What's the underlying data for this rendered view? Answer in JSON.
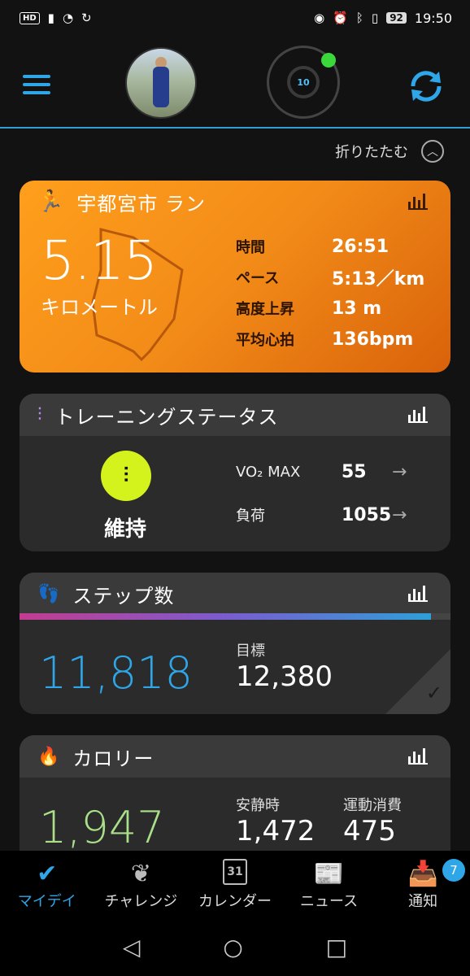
{
  "status_bar": {
    "left_badge": "HD",
    "battery": "92",
    "time": "19:50"
  },
  "header": {
    "watch_face_text": "10"
  },
  "collapse_label": "折りたたむ",
  "activity": {
    "title": "宇都宮市 ラン",
    "distance": "5.15",
    "distance_unit": "キロメートル",
    "stats": [
      {
        "label": "時間",
        "value": "26:51"
      },
      {
        "label": "ペース",
        "value": "5:13／km"
      },
      {
        "label": "高度上昇",
        "value": "13 m"
      },
      {
        "label": "平均心拍",
        "value": "136bpm"
      }
    ]
  },
  "training": {
    "title": "トレーニングステータス",
    "status": "維持",
    "vo2_label": "VO₂ MAX",
    "vo2_value": "55",
    "load_label": "負荷",
    "load_value": "1055"
  },
  "steps": {
    "title": "ステップ数",
    "count": "11,818",
    "goal_label": "目標",
    "goal": "12,380",
    "progress_fraction": 0.955
  },
  "calories": {
    "title": "カロリー",
    "total": "1,947",
    "resting_label": "安静時",
    "resting": "1,472",
    "active_label": "運動消費",
    "active": "475"
  },
  "bottom_nav": [
    {
      "label": "マイデイ",
      "icon": "check-icon"
    },
    {
      "label": "チャレンジ",
      "icon": "laurel-icon"
    },
    {
      "label": "カレンダー",
      "icon": "calendar-icon",
      "day": "31"
    },
    {
      "label": "ニュース",
      "icon": "newspaper-icon"
    },
    {
      "label": "通知",
      "icon": "inbox-icon",
      "badge": "7"
    }
  ],
  "colors": {
    "accent": "#2ea6e8",
    "activity_orange": "#f28b18",
    "training_lime": "#d4f21c",
    "calories_green": "#a9e089"
  }
}
